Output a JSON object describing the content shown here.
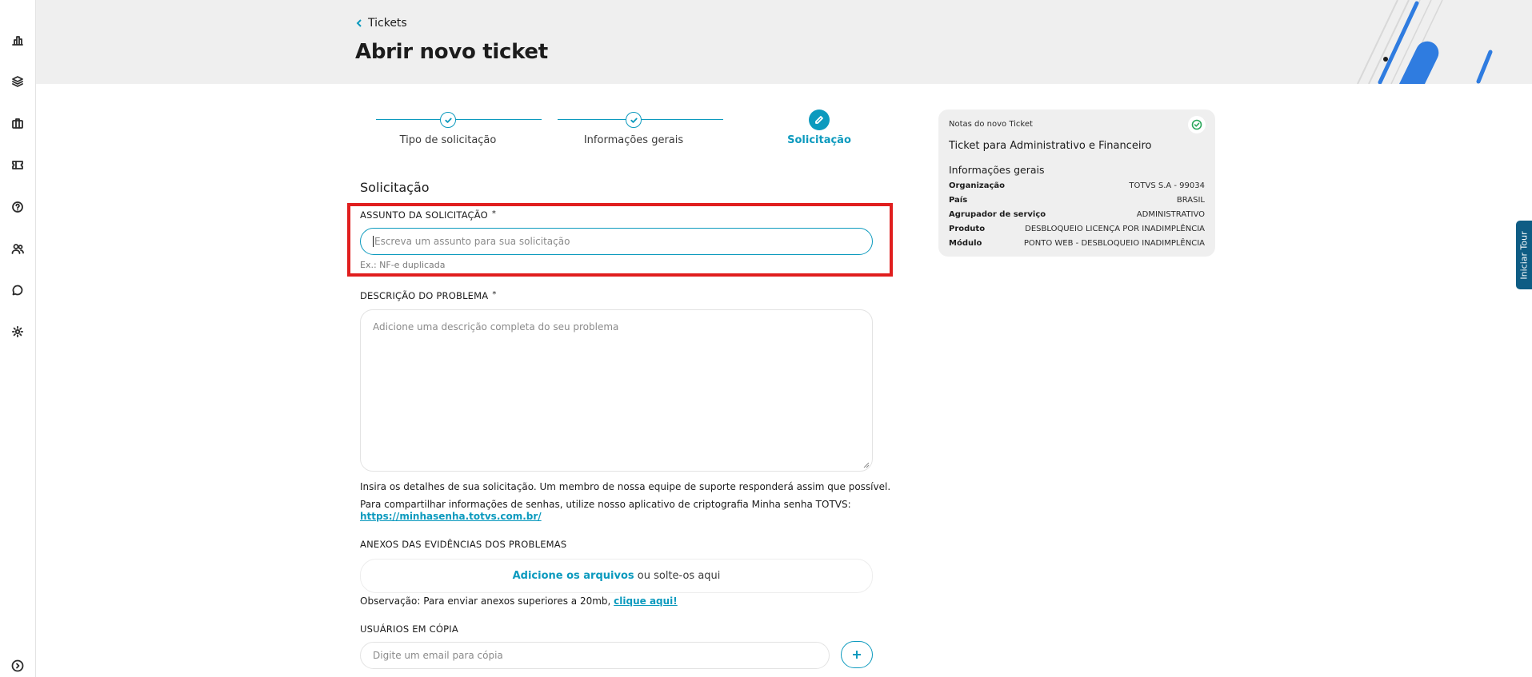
{
  "sidebar": {
    "icons": [
      "chart-bar-icon",
      "layers-icon",
      "briefcase-icon",
      "ticket-icon",
      "help-icon",
      "users-icon",
      "chat-icon",
      "gear-icon"
    ],
    "expand_icon": "chevron-right-circle-icon"
  },
  "header": {
    "back_label": "Tickets",
    "title": "Abrir novo ticket"
  },
  "stepper": {
    "steps": [
      {
        "label": "Tipo de solicitação",
        "state": "done"
      },
      {
        "label": "Informações gerais",
        "state": "done"
      },
      {
        "label": "Solicitação",
        "state": "active"
      }
    ]
  },
  "form": {
    "section_title": "Solicitação",
    "subject": {
      "label": "ASSUNTO DA SOLICITAÇÃO",
      "required_mark": "*",
      "value": "",
      "placeholder": "Escreva um assunto para sua solicitação",
      "helper": "Ex.: NF-e duplicada"
    },
    "description": {
      "label": "DESCRIÇÃO DO PROBLEMA",
      "required_mark": "*",
      "placeholder": "Adicione uma descrição completa do seu problema"
    },
    "details_note": "Insira os detalhes de sua solicitação. Um membro de nossa equipe de suporte responderá assim que possível.",
    "password_note": "Para compartilhar informações de senhas, utilize nosso aplicativo de criptografia Minha senha TOTVS:",
    "password_link": "https://minhasenha.totvs.com.br/",
    "attachments": {
      "label": "ANEXOS DAS EVIDÊNCIAS DOS PROBLEMAS",
      "add_link": "Adicione os arquivos",
      "drop_text": " ou solte-os aqui",
      "note_prefix": "Observação: Para enviar anexos superiores a 20mb, ",
      "note_link": "clique aqui!"
    },
    "cc": {
      "label": "USUÁRIOS EM CÓPIA",
      "placeholder": "Digite um email para cópia"
    }
  },
  "notes_card": {
    "header": "Notas do novo Ticket",
    "title": "Ticket para Administrativo e Financeiro",
    "subtitle": "Informações gerais",
    "rows": [
      {
        "key": "Organização",
        "value": "TOTVS S.A - 99034"
      },
      {
        "key": "País",
        "value": "BRASIL"
      },
      {
        "key": "Agrupador de serviço",
        "value": "ADMINISTRATIVO"
      },
      {
        "key": "Produto",
        "value": "DESBLOQUEIO LICENÇA POR INADIMPLÊNCIA"
      },
      {
        "key": "Módulo",
        "value": "PONTO WEB - DESBLOQUEIO INADIMPLÊNCIA"
      }
    ]
  },
  "tour_label": "Iniciar Tour",
  "colors": {
    "accent": "#0c9abe",
    "highlight": "#e01e1e",
    "header_bg": "#efefef",
    "success": "#2aa75a",
    "tour_bg": "#0e5c84"
  }
}
